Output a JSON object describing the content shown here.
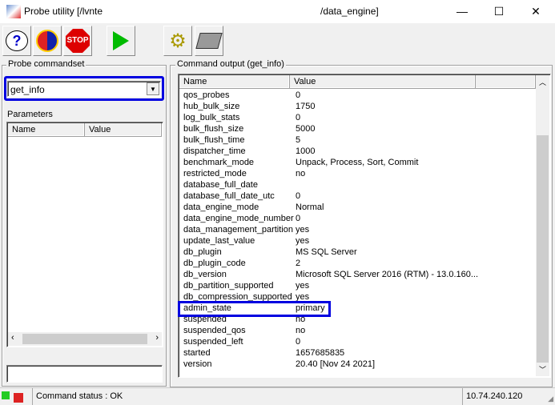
{
  "window": {
    "title_left": "Probe utility [/lvnte",
    "title_right": "/data_engine]",
    "minimize": "—",
    "maximize": "☐",
    "close": "✕"
  },
  "toolbar": [
    {
      "name": "help",
      "glyph": "?"
    },
    {
      "name": "refresh",
      "glyph": "⟳"
    },
    {
      "name": "stop",
      "glyph": "STOP"
    },
    {
      "name": "run",
      "glyph": "▶"
    },
    {
      "name": "settings",
      "glyph": "⚙"
    },
    {
      "name": "print",
      "glyph": "🖶"
    }
  ],
  "left": {
    "commandset_label": "Probe commandset",
    "commandset_value": "get_info",
    "parameters_label": "Parameters",
    "columns": [
      "Name",
      "Value"
    ],
    "input_value": ""
  },
  "output": {
    "label": "Command output (get_info)",
    "columns": [
      "Name",
      "Value",
      ""
    ],
    "rows": [
      [
        "qos_probes",
        "0"
      ],
      [
        "hub_bulk_size",
        "1750"
      ],
      [
        "log_bulk_stats",
        "0"
      ],
      [
        "bulk_flush_size",
        "5000"
      ],
      [
        "bulk_flush_time",
        "5"
      ],
      [
        "dispatcher_time",
        "1000"
      ],
      [
        "benchmark_mode",
        "Unpack, Process, Sort, Commit"
      ],
      [
        "restricted_mode",
        "no"
      ],
      [
        "database_full_date",
        ""
      ],
      [
        "database_full_date_utc",
        "0"
      ],
      [
        "data_engine_mode",
        "Normal"
      ],
      [
        "data_engine_mode_number",
        "0"
      ],
      [
        "data_management_partition",
        "yes"
      ],
      [
        "update_last_value",
        "yes"
      ],
      [
        "db_plugin",
        "MS SQL Server"
      ],
      [
        "db_plugin_code",
        "2"
      ],
      [
        "db_version",
        "Microsoft SQL Server 2016 (RTM) - 13.0.160..."
      ],
      [
        "db_partition_supported",
        "yes"
      ],
      [
        "db_compression_supported",
        "yes"
      ],
      [
        "admin_state",
        "primary"
      ],
      [
        "suspended",
        "no"
      ],
      [
        "suspended_qos",
        "no"
      ],
      [
        "suspended_left",
        "0"
      ],
      [
        "started",
        "1657685835"
      ],
      [
        "version",
        "20.40 [Nov 24 2021]"
      ]
    ],
    "highlight_row": 19
  },
  "status": {
    "text": "Command status : OK",
    "ip": "10.74.240.120"
  },
  "colors": {
    "highlight": "#0000e0"
  }
}
